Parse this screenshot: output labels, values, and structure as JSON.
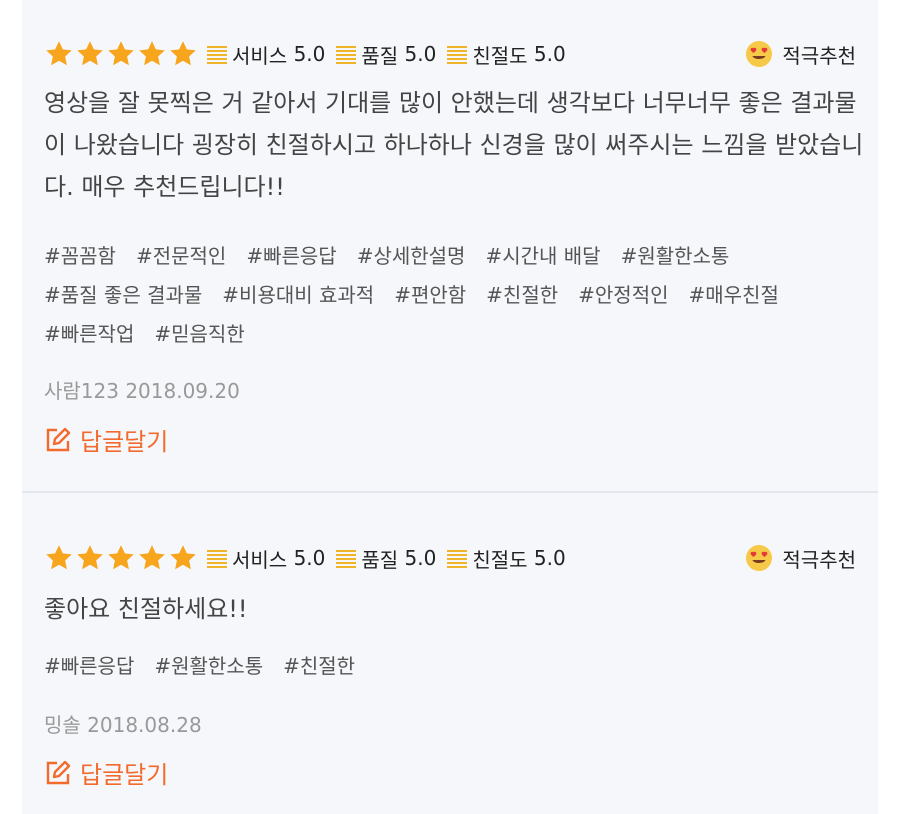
{
  "reviews": [
    {
      "stars": 5,
      "metrics": [
        {
          "label": "서비스",
          "value": "5.0"
        },
        {
          "label": "품질",
          "value": "5.0"
        },
        {
          "label": "친절도",
          "value": "5.0"
        }
      ],
      "recommend_label": "적극추천",
      "content": "영상을 잘 못찍은 거 같아서 기대를 많이 안했는데 생각보다 너무너무 좋은 결과물이 나왔습니다 굉장히 친절하시고 하나하나 신경을 많이 써주시는 느낌을 받았습니다. 매우 추천드립니다!!",
      "tags": [
        "#꼼꼼함",
        "#전문적인",
        "#빠른응답",
        "#상세한설명",
        "#시간내 배달",
        "#원활한소통",
        "#품질 좋은 결과물",
        "#비용대비 효과적",
        "#편안함",
        "#친절한",
        "#안정적인",
        "#매우친절",
        "#빠른작업",
        "#믿음직한"
      ],
      "author_date": "사람123 2018.09.20",
      "reply_label": "답글달기"
    },
    {
      "stars": 5,
      "metrics": [
        {
          "label": "서비스",
          "value": "5.0"
        },
        {
          "label": "품질",
          "value": "5.0"
        },
        {
          "label": "친절도",
          "value": "5.0"
        }
      ],
      "recommend_label": "적극추천",
      "content": "좋아요 친절하세요!!",
      "tags": [
        "#빠른응답",
        "#원활한소통",
        "#친절한"
      ],
      "author_date": "밍솔 2018.08.28",
      "reply_label": "답글달기"
    }
  ],
  "colors": {
    "star": "#f7a51c",
    "bars_icon": "#f0b429",
    "reply": "#f26b2c",
    "meta": "#999999"
  },
  "icons": {
    "star": "star-icon",
    "metric": "bars-icon",
    "recommend": "heart-eyes-emoji-icon",
    "reply": "edit-icon"
  }
}
